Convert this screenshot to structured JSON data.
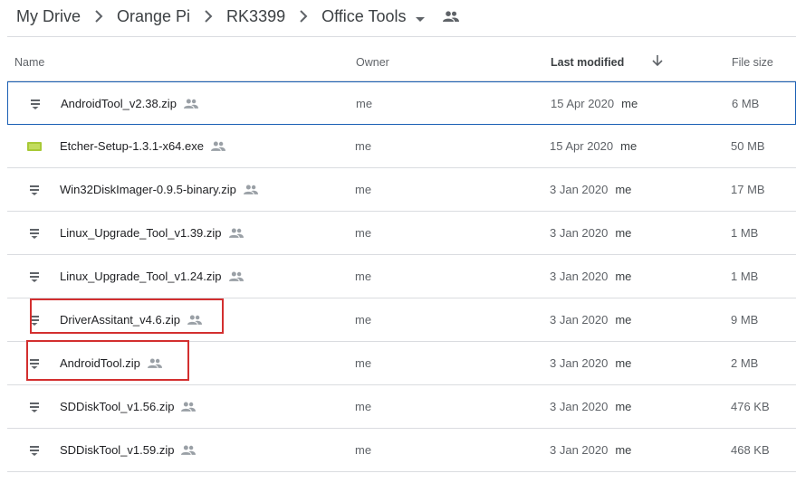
{
  "breadcrumb": {
    "items": [
      "My Drive",
      "Orange Pi",
      "RK3399"
    ],
    "current": "Office Tools"
  },
  "table": {
    "headers": {
      "name": "Name",
      "owner": "Owner",
      "last_modified": "Last modified",
      "file_size": "File size"
    },
    "sort": "last_modified-desc",
    "rows": [
      {
        "name": "AndroidTool_v2.38.zip",
        "icon": "zip-icon",
        "owner": "me",
        "modified": "15 Apr 2020",
        "modified_by": "me",
        "size": "6 MB",
        "selected": true
      },
      {
        "name": "Etcher-Setup-1.3.1-x64.exe",
        "icon": "exe-icon",
        "owner": "me",
        "modified": "15 Apr 2020",
        "modified_by": "me",
        "size": "50 MB"
      },
      {
        "name": "Win32DiskImager-0.9.5-binary.zip",
        "icon": "zip-icon",
        "owner": "me",
        "modified": "3 Jan 2020",
        "modified_by": "me",
        "size": "17 MB"
      },
      {
        "name": "Linux_Upgrade_Tool_v1.39.zip",
        "icon": "zip-icon",
        "owner": "me",
        "modified": "3 Jan 2020",
        "modified_by": "me",
        "size": "1 MB"
      },
      {
        "name": "Linux_Upgrade_Tool_v1.24.zip",
        "icon": "zip-icon",
        "owner": "me",
        "modified": "3 Jan 2020",
        "modified_by": "me",
        "size": "1 MB"
      },
      {
        "name": "DriverAssitant_v4.6.zip",
        "icon": "zip-icon",
        "owner": "me",
        "modified": "3 Jan 2020",
        "modified_by": "me",
        "size": "9 MB",
        "highlighted": true
      },
      {
        "name": "AndroidTool.zip",
        "icon": "zip-icon",
        "owner": "me",
        "modified": "3 Jan 2020",
        "modified_by": "me",
        "size": "2 MB",
        "highlighted": true
      },
      {
        "name": "SDDiskTool_v1.56.zip",
        "icon": "zip-icon",
        "owner": "me",
        "modified": "3 Jan 2020",
        "modified_by": "me",
        "size": "476 KB"
      },
      {
        "name": "SDDiskTool_v1.59.zip",
        "icon": "zip-icon",
        "owner": "me",
        "modified": "3 Jan 2020",
        "modified_by": "me",
        "size": "468 KB"
      }
    ]
  },
  "colors": {
    "highlight_box": "#d32f2f",
    "selected_border": "#1a5fb4",
    "exe_icon": "#a8c937"
  }
}
